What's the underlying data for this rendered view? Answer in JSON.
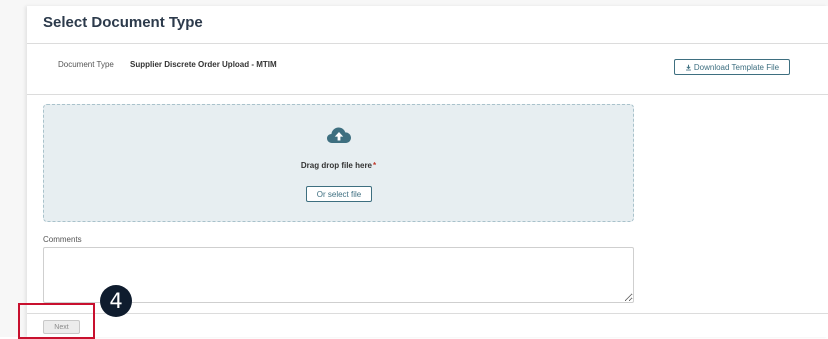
{
  "header": {
    "title": "Select Document Type"
  },
  "document_type": {
    "label": "Document Type",
    "value": "Supplier Discrete Order Upload - MTIM",
    "download_label": "Download Template File"
  },
  "upload": {
    "drop_text": "Drag drop file here",
    "required_marker": "*",
    "select_label": "Or select file"
  },
  "comments": {
    "label": "Comments",
    "value": ""
  },
  "footer": {
    "next_label": "Next"
  },
  "annotation": {
    "step_number": "4",
    "highlight_color": "#c8102e",
    "badge_color": "#0f1c2e"
  },
  "icons": {
    "download": "download-icon",
    "upload": "cloud-upload-icon"
  },
  "colors": {
    "accent": "#3e6f80",
    "dropzone_bg": "#e7eef1",
    "title": "#2c3a4b"
  }
}
